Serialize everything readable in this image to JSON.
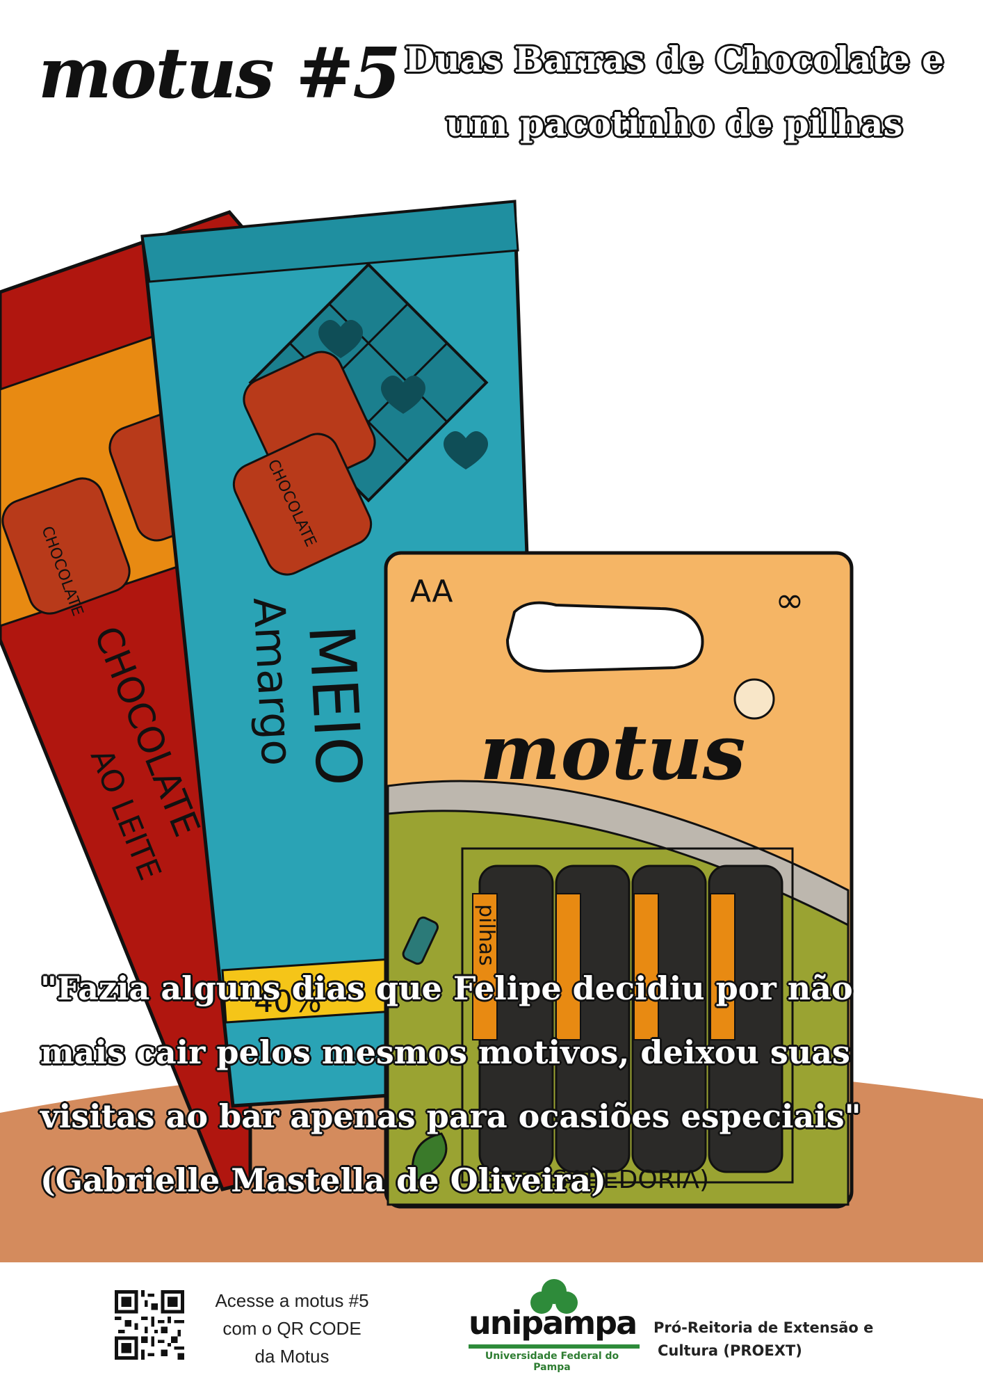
{
  "header": {
    "brand": "motus #5",
    "title_line1": "Duas Barras de Chocolate e",
    "title_line2": "um pacotinho de pilhas"
  },
  "illustration": {
    "milk_bar": {
      "text_line1": "CHOCOLATE",
      "text_line2": "AO LEITE",
      "square_label": "CHOCOLATE",
      "color": "#b0160f",
      "accent": "#e88a12"
    },
    "dark_bar": {
      "text_line1": "MEIO",
      "text_line2": "Amargo",
      "percent": "40%",
      "square_label": "CHOCOLATE",
      "color": "#2aa3b5",
      "accent": "#f5c518"
    },
    "battery_pack": {
      "size_label": "AA",
      "brand": "motus",
      "battery_label": "pilhas",
      "bottom_label": "(SABEDORIA)",
      "card_color": "#f5b565",
      "green_color": "#9aa332"
    },
    "ground_color": "#d48b5d"
  },
  "quote": {
    "line1": "\"Fazia alguns dias que Felipe decidiu por não",
    "line2": "mais cair pelos mesmos motivos, deixou suas",
    "line3": "visitas ao bar apenas para ocasiões especiais\"",
    "line4": "(Gabrielle Mastella de Oliveira)"
  },
  "footer": {
    "qr_caption_line1": "Acesse a motus #5",
    "qr_caption_line2": "com o QR CODE",
    "qr_caption_line3": "da Motus",
    "university_name": "unipampa",
    "university_full": "Universidade Federal do Pampa",
    "dept_line1": "Pró-Reitoria de Extensão e",
    "dept_line2": "Cultura (PROEXT)",
    "brand_green": "#2e8b3a"
  }
}
